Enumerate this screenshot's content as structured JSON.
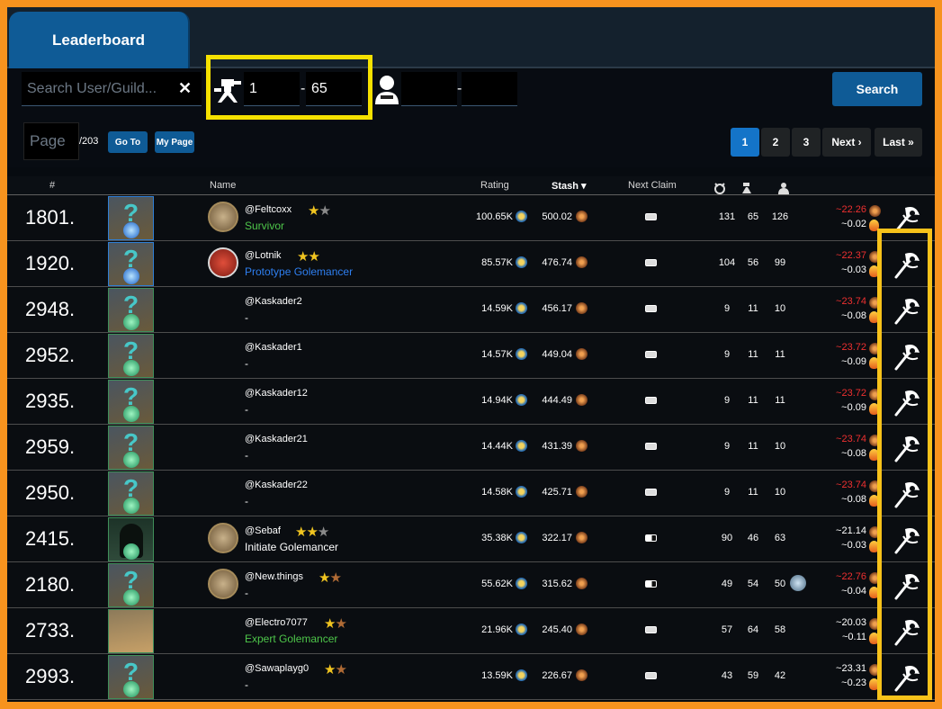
{
  "header": {
    "tab_label": "Leaderboard"
  },
  "filters": {
    "search_placeholder": "Search User/Guild...",
    "level_min": "1",
    "level_max": "65",
    "worker_min": "",
    "worker_max": "",
    "search_label": "Search",
    "page_placeholder": "Page",
    "page_total": "/203",
    "goto_label": "Go To",
    "mypage_label": "My Page"
  },
  "pagination": {
    "pages": [
      "1",
      "2",
      "3"
    ],
    "next": "Next ›",
    "last": "Last »",
    "active": "1"
  },
  "columns": {
    "rank": "#",
    "name": "Name",
    "rating": "Rating",
    "stash": "Stash ▾",
    "next_claim": "Next Claim"
  },
  "rows": [
    {
      "rank": "1801.",
      "user": "@Feltcoxx",
      "title": "Survivor",
      "title_color": "green",
      "rating": "100.65K",
      "stash": "500.02",
      "c1": "131",
      "c2": "65",
      "c3": "126",
      "d1": "~22.26",
      "d1_color": "red",
      "d2": "~0.02"
    },
    {
      "rank": "1920.",
      "user": "@Lotnik",
      "title": "Prototype Golemancer",
      "title_color": "blue",
      "rating": "85.57K",
      "stash": "476.74",
      "c1": "104",
      "c2": "56",
      "c3": "99",
      "d1": "~22.37",
      "d1_color": "red",
      "d2": "~0.03"
    },
    {
      "rank": "2948.",
      "user": "@Kaskader2",
      "title": "-",
      "title_color": "white",
      "rating": "14.59K",
      "stash": "456.17",
      "c1": "9",
      "c2": "11",
      "c3": "10",
      "d1": "~23.74",
      "d1_color": "red",
      "d2": "~0.08"
    },
    {
      "rank": "2952.",
      "user": "@Kaskader1",
      "title": "-",
      "title_color": "white",
      "rating": "14.57K",
      "stash": "449.04",
      "c1": "9",
      "c2": "11",
      "c3": "11",
      "d1": "~23.72",
      "d1_color": "red",
      "d2": "~0.09"
    },
    {
      "rank": "2935.",
      "user": "@Kaskader12",
      "title": "-",
      "title_color": "white",
      "rating": "14.94K",
      "stash": "444.49",
      "c1": "9",
      "c2": "11",
      "c3": "11",
      "d1": "~23.72",
      "d1_color": "red",
      "d2": "~0.09"
    },
    {
      "rank": "2959.",
      "user": "@Kaskader21",
      "title": "-",
      "title_color": "white",
      "rating": "14.44K",
      "stash": "431.39",
      "c1": "9",
      "c2": "11",
      "c3": "10",
      "d1": "~23.74",
      "d1_color": "red",
      "d2": "~0.08"
    },
    {
      "rank": "2950.",
      "user": "@Kaskader22",
      "title": "-",
      "title_color": "white",
      "rating": "14.58K",
      "stash": "425.71",
      "c1": "9",
      "c2": "11",
      "c3": "10",
      "d1": "~23.74",
      "d1_color": "red",
      "d2": "~0.08"
    },
    {
      "rank": "2415.",
      "user": "@Sebaf",
      "title": "Initiate Golemancer",
      "title_color": "white",
      "rating": "35.38K",
      "stash": "322.17",
      "c1": "90",
      "c2": "46",
      "c3": "63",
      "d1": "~21.14",
      "d1_color": "white",
      "d2": "~0.03"
    },
    {
      "rank": "2180.",
      "user": "@New.things",
      "title": "-",
      "title_color": "white",
      "rating": "55.62K",
      "stash": "315.62",
      "c1": "49",
      "c2": "54",
      "c3": "50",
      "d1": "~22.76",
      "d1_color": "red",
      "d2": "~0.04"
    },
    {
      "rank": "2733.",
      "user": "@Electro7077",
      "title": "Expert Golemancer",
      "title_color": "green",
      "rating": "21.96K",
      "stash": "245.40",
      "c1": "57",
      "c2": "64",
      "c3": "58",
      "d1": "~20.03",
      "d1_color": "white",
      "d2": "~0.11"
    },
    {
      "rank": "2993.",
      "user": "@Sawaplayg0",
      "title": "-",
      "title_color": "white",
      "rating": "13.59K",
      "stash": "226.67",
      "c1": "43",
      "c2": "59",
      "c3": "42",
      "d1": "~23.31",
      "d1_color": "white",
      "d2": "~0.23"
    }
  ]
}
